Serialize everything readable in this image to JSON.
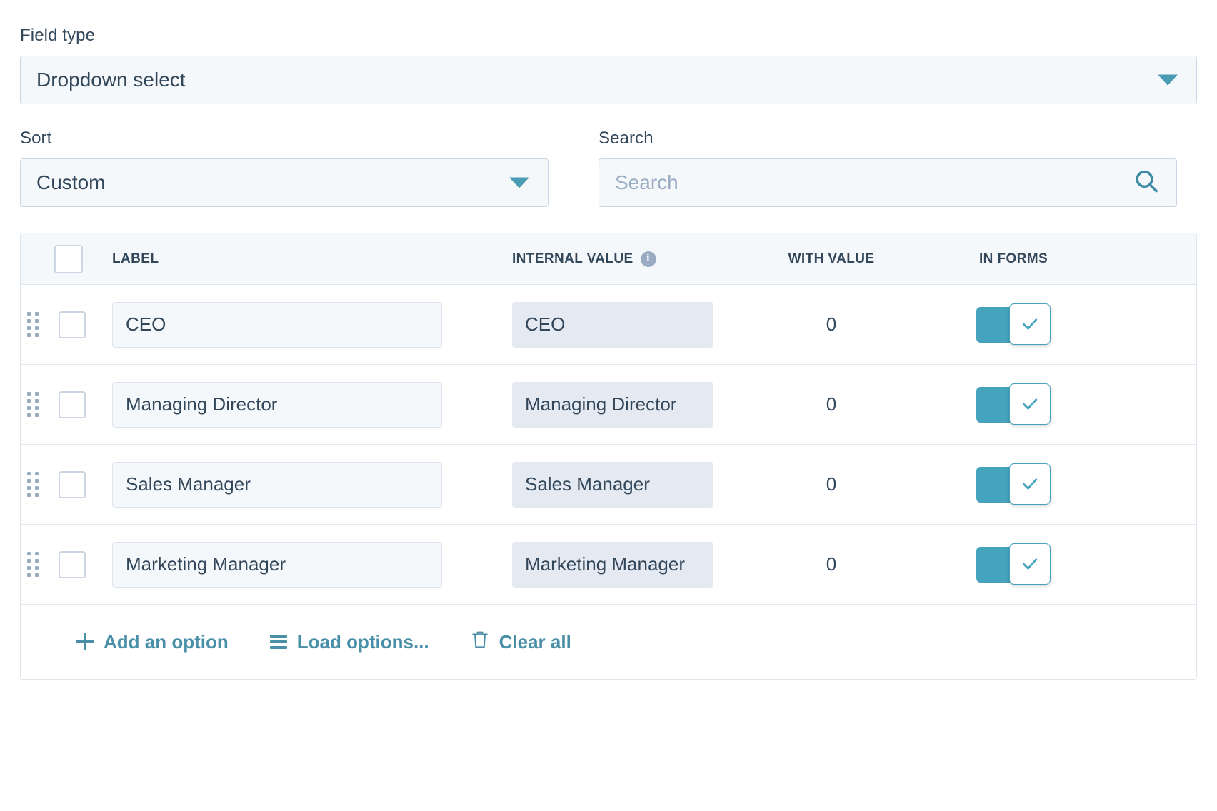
{
  "field_type": {
    "label": "Field type",
    "value": "Dropdown select",
    "caret_icon": "chevron-down-icon"
  },
  "sort": {
    "label": "Sort",
    "value": "Custom",
    "caret_icon": "chevron-down-icon"
  },
  "search": {
    "label": "Search",
    "value": "",
    "placeholder": "Search",
    "icon": "search-icon"
  },
  "table": {
    "columns": {
      "label": "LABEL",
      "internal_value": "INTERNAL VALUE",
      "internal_value_info_icon": "info-icon",
      "with_value": "WITH VALUE",
      "in_forms": "IN FORMS"
    },
    "rows": [
      {
        "label": "CEO",
        "internal_value": "CEO",
        "with_value": "0",
        "in_forms": true
      },
      {
        "label": "Managing Director",
        "internal_value": "Managing Director",
        "with_value": "0",
        "in_forms": true
      },
      {
        "label": "Sales Manager",
        "internal_value": "Sales Manager",
        "with_value": "0",
        "in_forms": true
      },
      {
        "label": "Marketing Manager",
        "internal_value": "Marketing Manager",
        "with_value": "0",
        "in_forms": true
      }
    ]
  },
  "footer": {
    "add_option": "Add an option",
    "add_option_icon": "plus-icon",
    "load_options": "Load options...",
    "load_options_icon": "list-lines-icon",
    "clear_all": "Clear all",
    "clear_all_icon": "trash-icon"
  },
  "colors": {
    "accent_teal": "#45a3bd",
    "link_teal": "#4a8fa8",
    "text": "#33475b",
    "placeholder": "#99acc2",
    "field_bg": "#f5f8fa",
    "value_bg": "#e5eaf2",
    "border": "#cbd6e2"
  }
}
